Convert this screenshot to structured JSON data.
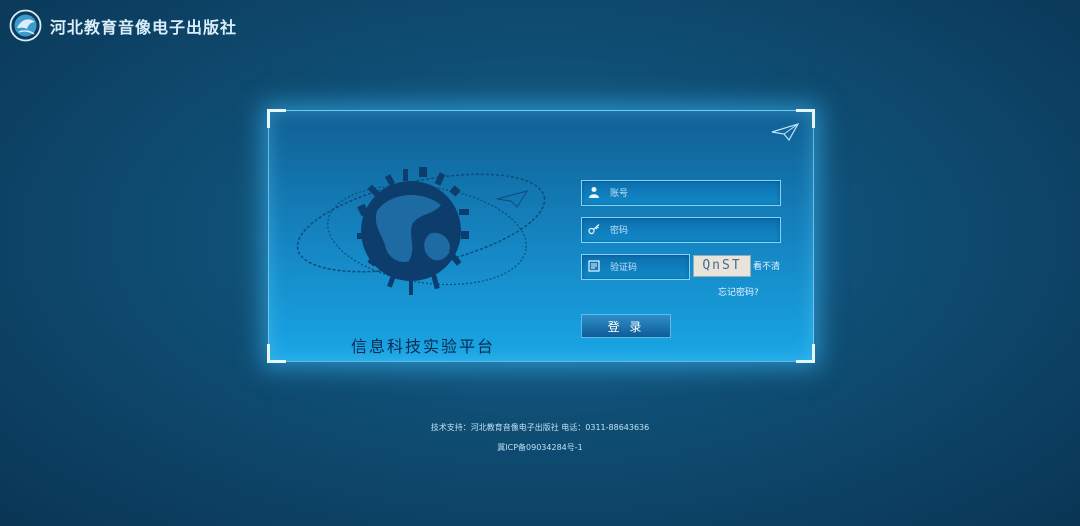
{
  "header": {
    "publisher_name": "河北教育音像电子出版社",
    "logo_icon": "publisher-logo-icon"
  },
  "panel": {
    "platform_title": "信息科技实验平台",
    "globe_image": "globe-illustration",
    "plane_icon": "paper-plane-icon"
  },
  "login": {
    "username_placeholder": "账号",
    "password_placeholder": "密码",
    "captcha_placeholder": "验证码",
    "captcha_text": "QnST",
    "refresh_label": "看不清",
    "forgot_label": "忘记密码?",
    "login_label": "登 录",
    "user_icon": "user-icon",
    "key_icon": "key-icon",
    "captcha_icon": "captcha-icon"
  },
  "footer": {
    "support_text": "技术支持：河北教育音像电子出版社 电话：0311-88643636",
    "icp_text": "冀ICP备09034284号-1"
  },
  "colors": {
    "accent": "#19a6e6",
    "dark_bg": "#0a3554"
  }
}
